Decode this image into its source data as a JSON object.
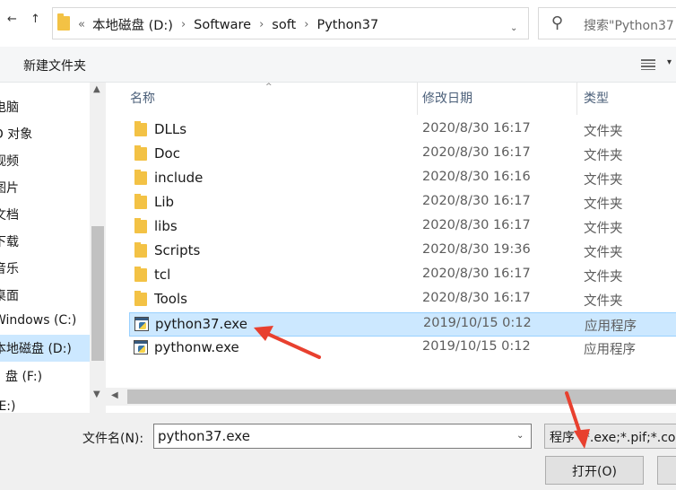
{
  "address": {
    "lead": "«",
    "crumbs": [
      "本地磁盘 (D:)",
      "Software",
      "soft",
      "Python37"
    ],
    "dropdown_icon": "chevron-down-icon",
    "refresh_icon": "refresh-icon"
  },
  "search": {
    "placeholder": "搜索\"Python37"
  },
  "toolbar": {
    "new_folder_label": "新建文件夹"
  },
  "nav": {
    "items": [
      {
        "label": "电脑"
      },
      {
        "label": "D 对象"
      },
      {
        "label": "视频"
      },
      {
        "label": "图片"
      },
      {
        "label": "文档"
      },
      {
        "label": "下载"
      },
      {
        "label": "音乐"
      },
      {
        "label": "桌面"
      },
      {
        "label": "Windows (C:)"
      },
      {
        "label": "本地磁盘 (D:)"
      },
      {
        "label": "盘 (F:)"
      },
      {
        "label": "(E:)"
      }
    ],
    "selected": "本地磁盘 (D:)"
  },
  "columns": {
    "name": "名称",
    "date": "修改日期",
    "type": "类型"
  },
  "files": [
    {
      "name": "DLLs",
      "date": "2020/8/30 16:17",
      "type": "文件夹",
      "icon": "folder-icon"
    },
    {
      "name": "Doc",
      "date": "2020/8/30 16:17",
      "type": "文件夹",
      "icon": "folder-icon"
    },
    {
      "name": "include",
      "date": "2020/8/30 16:16",
      "type": "文件夹",
      "icon": "folder-icon"
    },
    {
      "name": "Lib",
      "date": "2020/8/30 16:17",
      "type": "文件夹",
      "icon": "folder-icon"
    },
    {
      "name": "libs",
      "date": "2020/8/30 16:17",
      "type": "文件夹",
      "icon": "folder-icon"
    },
    {
      "name": "Scripts",
      "date": "2020/8/30 19:36",
      "type": "文件夹",
      "icon": "folder-icon"
    },
    {
      "name": "tcl",
      "date": "2020/8/30 16:17",
      "type": "文件夹",
      "icon": "folder-icon"
    },
    {
      "name": "Tools",
      "date": "2020/8/30 16:17",
      "type": "文件夹",
      "icon": "folder-icon"
    },
    {
      "name": "python37.exe",
      "date": "2019/10/15 0:12",
      "type": "应用程序",
      "icon": "python-exe-icon",
      "selected": true
    },
    {
      "name": "pythonw.exe",
      "date": "2019/10/15 0:12",
      "type": "应用程序",
      "icon": "python-exe-icon"
    }
  ],
  "bottom": {
    "filename_label": "文件名(N):",
    "filename_value": "python37.exe",
    "filter_value": "程序 (*.exe;*.pif;*.com",
    "open_label": "打开(O)"
  },
  "colors": {
    "selection": "#cce8ff",
    "selection_border": "#99d1ff",
    "arrow": "#e8402f",
    "folder": "#f3c245"
  }
}
